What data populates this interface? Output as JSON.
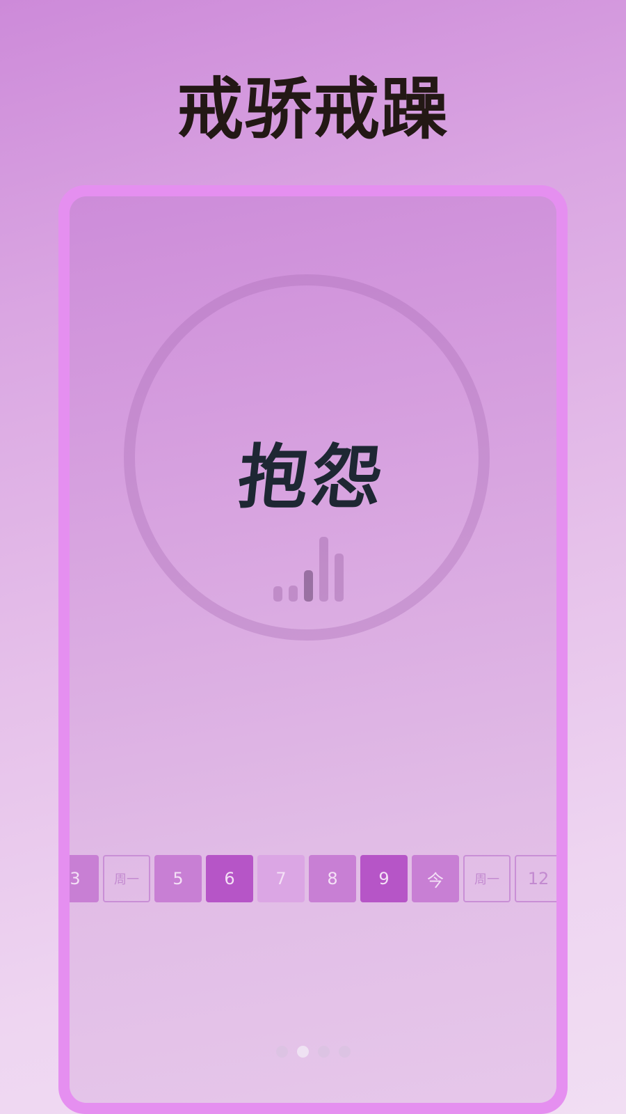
{
  "headline": "戒骄戒躁",
  "main": {
    "word": "抱怨",
    "signal_level": 3,
    "signal_bars_total": 5
  },
  "calendar": {
    "days": [
      {
        "label": "3",
        "style": "medium"
      },
      {
        "label": "周一",
        "style": "outline"
      },
      {
        "label": "5",
        "style": "medium"
      },
      {
        "label": "6",
        "style": "strong"
      },
      {
        "label": "7",
        "style": "light"
      },
      {
        "label": "8",
        "style": "medium"
      },
      {
        "label": "9",
        "style": "strong"
      },
      {
        "label": "今",
        "style": "medium"
      },
      {
        "label": "周一",
        "style": "outline"
      },
      {
        "label": "12",
        "style": "outline"
      }
    ]
  },
  "pager": {
    "total_pages": 4,
    "current_page": 2
  },
  "colors": {
    "accent": "#b655c7",
    "frame": "#e58ff0",
    "headline_text": "#231815",
    "word_text": "#1e2733"
  }
}
